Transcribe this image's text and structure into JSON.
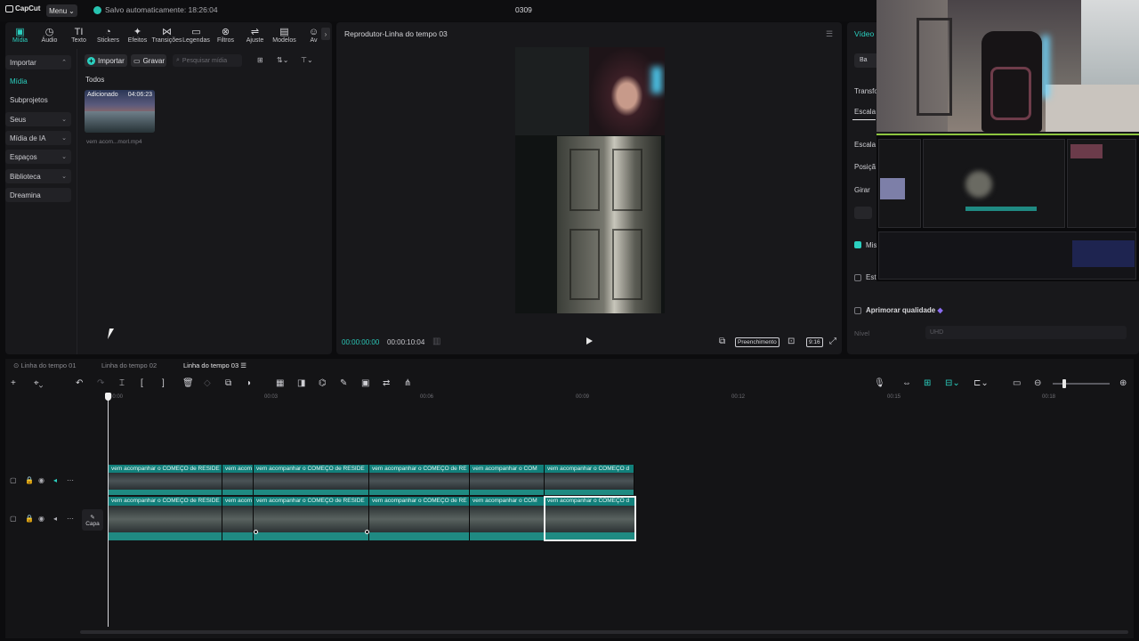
{
  "app": {
    "name": "CapCut",
    "menu_label": "Menu",
    "autosave": "Salvo automaticamente: 18:26:04",
    "project_title": "0309"
  },
  "tool_tabs": [
    {
      "label": "Mídia",
      "icon": "media-icon",
      "glyph": "▣",
      "active": true
    },
    {
      "label": "Áudio",
      "icon": "audio-icon",
      "glyph": "◷"
    },
    {
      "label": "Texto",
      "icon": "text-icon",
      "glyph": "TI"
    },
    {
      "label": "Stickers",
      "icon": "sticker-icon",
      "glyph": "◔"
    },
    {
      "label": "Efeitos",
      "icon": "effects-icon",
      "glyph": "✦"
    },
    {
      "label": "Transições",
      "icon": "transitions-icon",
      "glyph": "⋈"
    },
    {
      "label": "Legendas",
      "icon": "captions-icon",
      "glyph": "▭"
    },
    {
      "label": "Filtros",
      "icon": "filters-icon",
      "glyph": "⊗"
    },
    {
      "label": "Ajuste",
      "icon": "adjust-icon",
      "glyph": "⇌"
    },
    {
      "label": "Modelos",
      "icon": "templates-icon",
      "glyph": "▤"
    },
    {
      "label": "Av",
      "icon": "avatar-icon",
      "glyph": "☺"
    }
  ],
  "media_sidebar": [
    {
      "label": "Importar",
      "expandable": true
    },
    {
      "label": "Mídia",
      "active": true
    },
    {
      "label": "Subprojetos"
    },
    {
      "label": "Seus",
      "expandable": true
    },
    {
      "label": "Mídia de IA",
      "expandable": true
    },
    {
      "label": "Espaços",
      "expandable": true
    },
    {
      "label": "Biblioteca",
      "expandable": true
    },
    {
      "label": "Dreamina"
    }
  ],
  "media_toolbar": {
    "import": "Importar",
    "record": "Gravar",
    "search_placeholder": "Pesquisar mídia"
  },
  "media_list": {
    "group_label": "Todos",
    "items": [
      {
        "badge": "Adicionado",
        "duration": "04:06:23",
        "filename": "vem acom...morl.mp4"
      }
    ]
  },
  "player": {
    "title": "Reprodutor-Linha do tempo 03",
    "current_time": "00:00:00:00",
    "total_time": "00:00:10:04",
    "fill_label": "Preenchimento",
    "ratio_label": "9:16"
  },
  "right_panel": {
    "tab": "Vídeo",
    "button_partial": "Ba",
    "labels": {
      "transform": "Transfo",
      "scale_tab": "Escala",
      "scale": "Escala",
      "position": "Posiçã",
      "rotate": "Girar",
      "mix": "Mis",
      "stabilize": "Est"
    },
    "improve_quality": "Aprimorar qualidade",
    "level_label": "Nível",
    "level_value": "UHD"
  },
  "timeline": {
    "tabs": [
      {
        "label": "Linha do tempo 01"
      },
      {
        "label": "Linha do tempo 02"
      },
      {
        "label": "Linha do tempo 03",
        "active": true
      }
    ],
    "ruler": [
      "00:00",
      "00:03",
      "00:06",
      "00:09",
      "00:12",
      "00:15",
      "00:18"
    ],
    "cover_label": "Capa",
    "top_track_clips": [
      "vem acompanhar o COMEÇO de RESIDE",
      "vem acom",
      "vem acompanhar o COMEÇO de RESIDE",
      "vem acompanhar o COMEÇO de RE",
      "vem acompanhar o COM",
      "vem acompanhar o COMEÇO d"
    ],
    "main_track_clips": [
      "vem acompanhar o COMEÇO de RESIDE",
      "vem acom",
      "vem acompanhar o COMEÇO de RESIDE",
      "vem acompanhar o COMEÇO de RE",
      "vem acompanhar o COM",
      "vem acompanhar o COMEÇO d"
    ]
  },
  "colors": {
    "accent": "#2bd0c0",
    "panel": "#18181b",
    "background": "#0c0c0e"
  }
}
